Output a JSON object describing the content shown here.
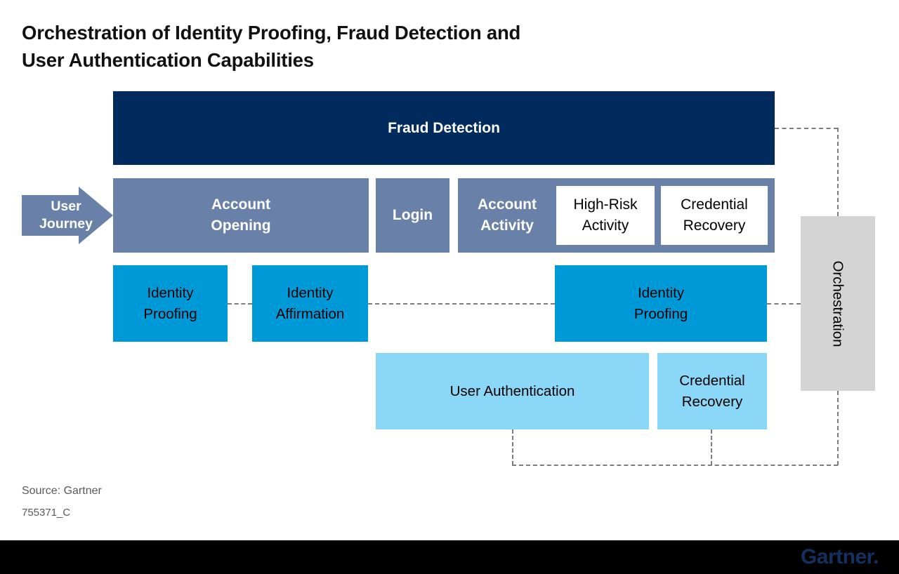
{
  "title": "Orchestration of Identity Proofing, Fraud Detection and\nUser Authentication Capabilities",
  "diagram": {
    "fraud_detection": {
      "label": "Fraud Detection"
    },
    "user_journey": {
      "label": "User\nJourney"
    },
    "journey_stages": [
      {
        "label": "Account\nOpening"
      },
      {
        "label": "Login"
      },
      {
        "label": "Account\nActivity"
      }
    ],
    "account_activity_insets": [
      {
        "label": "High-Risk\nActivity"
      },
      {
        "label": "Credential\nRecovery"
      }
    ],
    "capability_row_cyan": [
      {
        "label": "Identity\nProofing"
      },
      {
        "label": "Identity\nAffirmation"
      },
      {
        "label": "Identity\nProofing"
      }
    ],
    "capability_row_light": [
      {
        "label": "User Authentication"
      },
      {
        "label": "Credential\nRecovery"
      }
    ],
    "orchestration": {
      "label": "Orchestration"
    }
  },
  "footer": {
    "source": "Source: Gartner",
    "doc_id": "755371_C",
    "logo": "Gartner."
  },
  "colors": {
    "navy": "#002b5c",
    "slate": "#6981a8",
    "cyan": "#0099d8",
    "light_blue": "#8ad7f8",
    "gray_panel": "#d4d4d4",
    "dash_gray": "#7d7d7d",
    "footer_bar": "#000000",
    "logo_navy": "#14305f"
  }
}
